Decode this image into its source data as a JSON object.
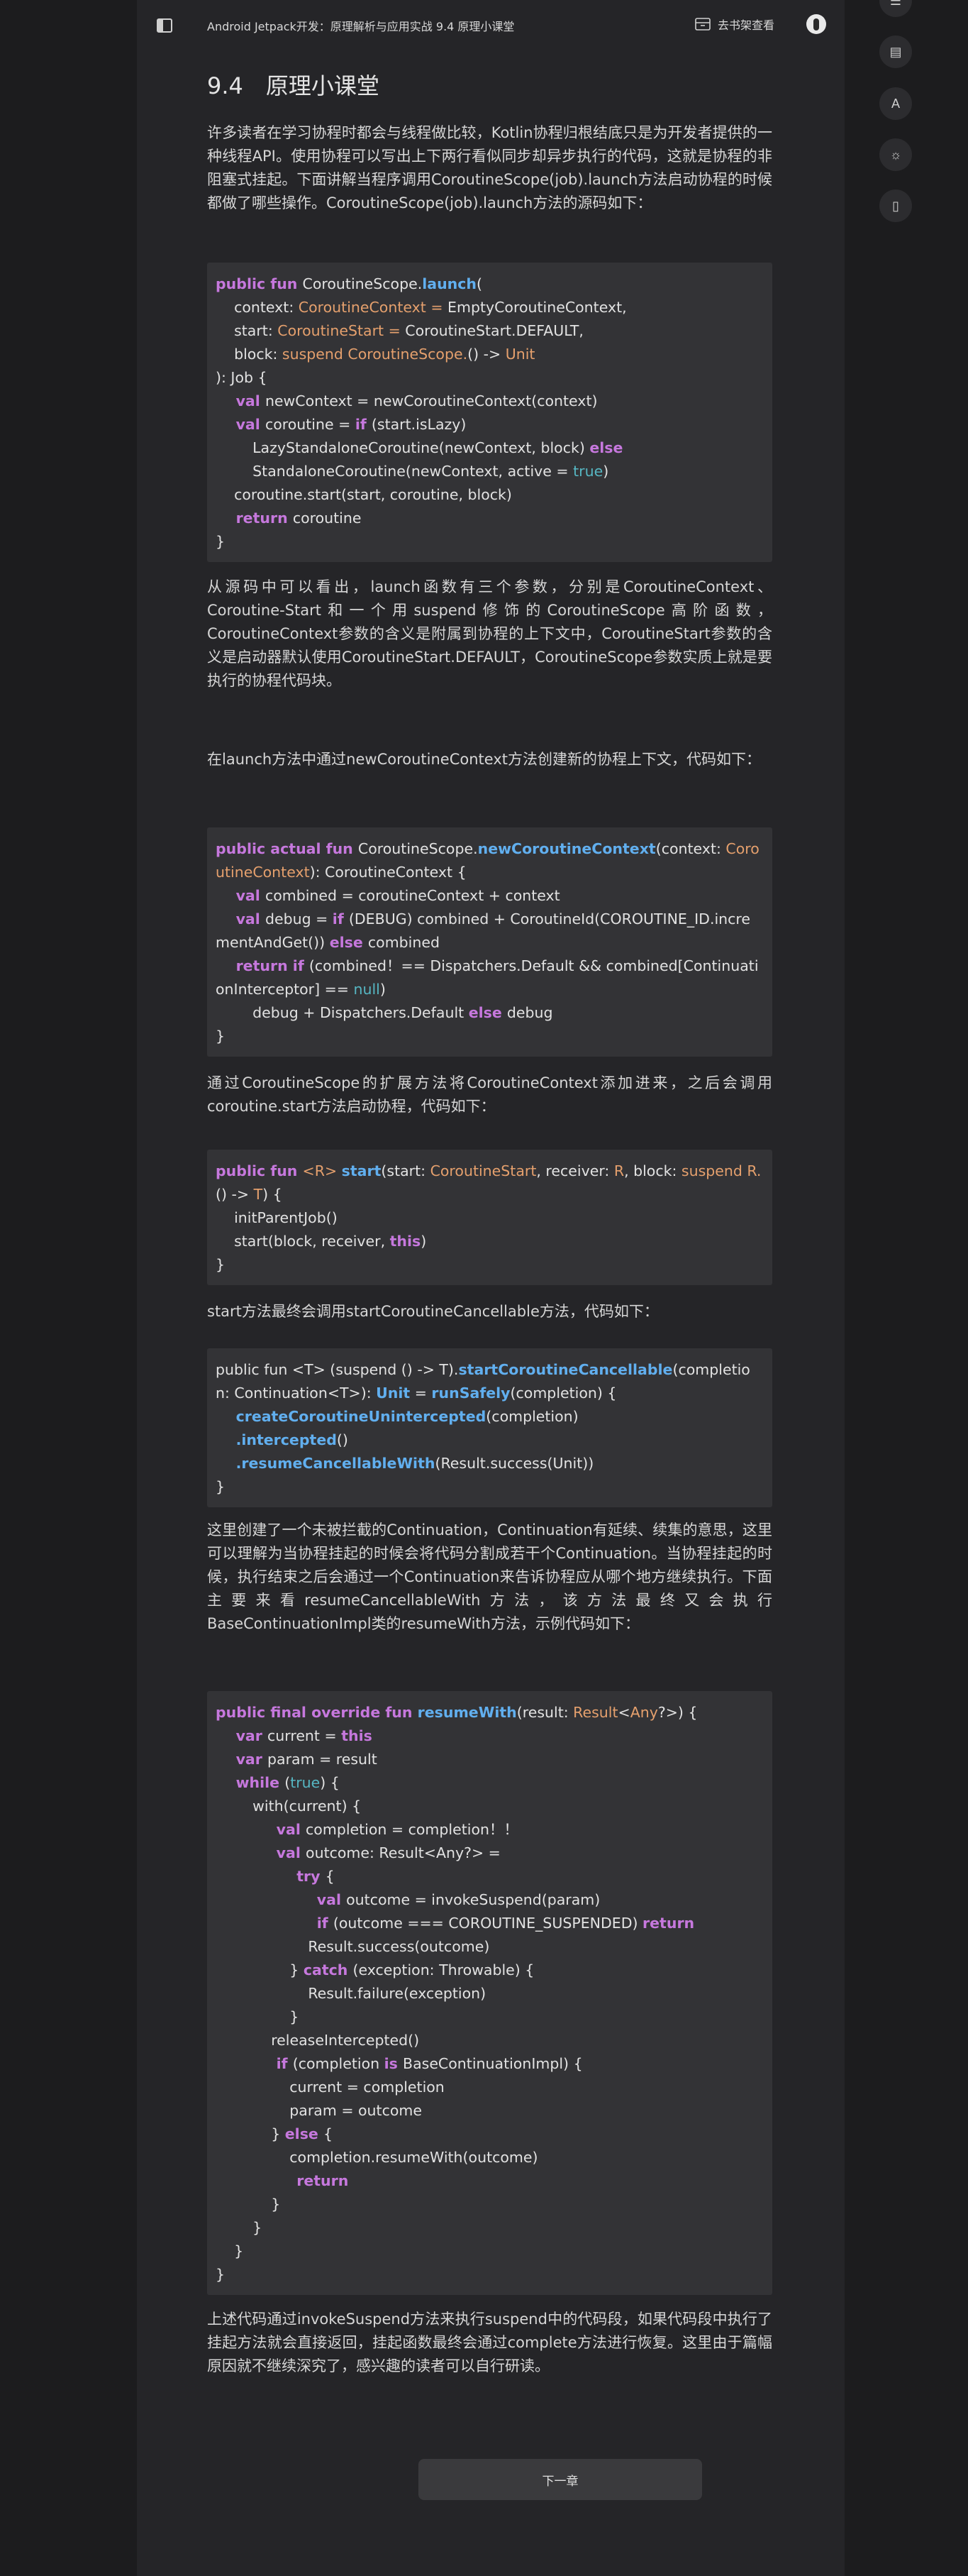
{
  "header": {
    "breadcrumb": "Android Jetpack开发：原理解析与应用实战 9.4 原理小课堂",
    "bookshelf_label": "去书架查看",
    "menu_icon": "menu-icon",
    "shelf_icon": "bookshelf-icon",
    "avatar_icon": "avatar-icon"
  },
  "article": {
    "title": "9.4　原理小课堂",
    "paragraphs": [
      "许多读者在学习协程时都会与线程做比较，Kotlin协程归根结底只是为开发者提供的一种线程API。使用协程可以写出上下两行看似同步却异步执行的代码，这就是协程的非阻塞式挂起。下面讲解当程序调用CoroutineScope(job).launch方法启动协程的时候都做了哪些操作。CoroutineScope(job).launch方法的源码如下：",
      "从源码中可以看出，launch函数有三个参数，分别是CoroutineContext、Coroutine-Start和一个用suspend修饰的CoroutineScope高阶函数，CoroutineContext参数的含义是附属到协程的上下文中，CoroutineStart参数的含义是启动器默认使用CoroutineStart.DEFAULT，CoroutineScope参数实质上就是要执行的协程代码块。",
      "在launch方法中通过newCoroutineContext方法创建新的协程上下文，代码如下：",
      "通过CoroutineScope的扩展方法将CoroutineContext添加进来，之后会调用coroutine.start方法启动协程，代码如下：",
      "start方法最终会调用startCoroutineCancellable方法，代码如下：",
      "这里创建了一个未被拦截的Continuation，Continuation有延续、续集的意思，这里可以理解为当协程挂起的时候会将代码分割成若干个Continuation。当协程挂起的时候，执行结束之后会通过一个Continuation来告诉协程应从哪个地方继续执行。下面主要来看resumeCancellableWith方法，该方法最终又会执行BaseContinuationImpl类的resumeWith方法，示例代码如下：",
      "上述代码通过invokeSuspend方法来执行suspend中的代码段，如果代码段中执行了挂起方法就会直接返回，挂起函数最终会通过complete方法进行恢复。这里由于篇幅原因就不继续深究了，感兴趣的读者可以自行研读。"
    ],
    "code_blocks": [
      [
        [
          [
            "kw",
            "public fun "
          ],
          [
            "",
            "CoroutineScope."
          ],
          [
            "fn",
            "launch"
          ],
          [
            "",
            "("
          ]
        ],
        [
          [
            "",
            "    context: "
          ],
          [
            "ty",
            "CoroutineContext"
          ],
          [
            "",
            ""
          ],
          [
            "ty",
            " = "
          ],
          [
            "",
            "EmptyCoroutineContext,"
          ]
        ],
        [
          [
            "",
            "    start: "
          ],
          [
            "ty",
            "CoroutineStart"
          ],
          [
            "ty",
            " = "
          ],
          [
            "",
            "CoroutineStart.DEFAULT,"
          ]
        ],
        [
          [
            "",
            "    block: "
          ],
          [
            "ty",
            "suspend CoroutineScope."
          ],
          [
            "",
            "() -> "
          ],
          [
            "ty",
            "Unit"
          ]
        ],
        [
          [
            "",
            "): Job {"
          ]
        ],
        [
          [
            "kw",
            "    val "
          ],
          [
            "",
            "newContext = newCoroutineContext(context)"
          ]
        ],
        [
          [
            "kw",
            "    val "
          ],
          [
            "",
            "coroutine = "
          ],
          [
            "kw",
            "if "
          ],
          [
            "",
            "(start.isLazy)"
          ]
        ],
        [
          [
            "",
            "        LazyStandaloneCoroutine(newContext, block) "
          ],
          [
            "kw",
            "else"
          ]
        ],
        [
          [
            "",
            "        StandaloneCoroutine(newContext, active = "
          ],
          [
            "lt",
            "true"
          ],
          [
            "",
            ")"
          ]
        ],
        [
          [
            "",
            "    coroutine.start(start, coroutine, block)"
          ]
        ],
        [
          [
            "kw",
            "    return "
          ],
          [
            "",
            "coroutine"
          ]
        ],
        [
          [
            "",
            "}"
          ]
        ]
      ],
      [
        [
          [
            "kw",
            "public actual fun "
          ],
          [
            "",
            "CoroutineScope."
          ],
          [
            "fn",
            "newCoroutineContext"
          ],
          [
            "",
            "(context: "
          ],
          [
            "ty",
            "CoroutineContext"
          ],
          [
            "",
            "): CoroutineContext {"
          ]
        ],
        [
          [
            "kw",
            "    val "
          ],
          [
            "",
            "combined = coroutineContext + context"
          ]
        ],
        [
          [
            "kw",
            "    val "
          ],
          [
            "",
            "debug = "
          ],
          [
            "kw",
            "if "
          ],
          [
            "",
            "(DEBUG) combined + CoroutineId(COROUTINE_ID.incrementAndGet()) "
          ],
          [
            "kw",
            "else "
          ],
          [
            "",
            "combined"
          ]
        ],
        [
          [
            "kw",
            "    return if "
          ],
          [
            "",
            "(combined！== Dispatchers.Default && combined[ContinuationInterceptor] == "
          ],
          [
            "lt",
            "null"
          ],
          [
            "",
            ")"
          ]
        ],
        [
          [
            "",
            "        debug + Dispatchers.Default "
          ],
          [
            "kw",
            "else "
          ],
          [
            "",
            "debug"
          ]
        ],
        [
          [
            "",
            "}"
          ]
        ]
      ],
      [
        [
          [
            "kw",
            "public fun "
          ],
          [
            "ty",
            "<R> "
          ],
          [
            "fn",
            "start"
          ],
          [
            "",
            "(start: "
          ],
          [
            "ty",
            "CoroutineStart"
          ],
          [
            "",
            ", receiver: "
          ],
          [
            "ty",
            "R"
          ],
          [
            "",
            ", block: "
          ],
          [
            "ty",
            "suspend R."
          ],
          [
            "",
            "() -> "
          ],
          [
            "ty",
            "T"
          ],
          [
            "",
            ") {"
          ]
        ],
        [
          [
            "",
            "    initParentJob()"
          ]
        ],
        [
          [
            "",
            "    start(block, receiver, "
          ],
          [
            "kw",
            "this"
          ],
          [
            "",
            ")"
          ]
        ],
        [
          [
            "",
            "}"
          ]
        ]
      ],
      [
        [
          [
            "",
            "public fun <T> (suspend () -> T)."
          ],
          [
            "fn",
            "startCoroutineCancellable"
          ],
          [
            "",
            "(completion: Continuation<T>): "
          ],
          [
            "fn",
            "Unit"
          ],
          [
            "",
            " = "
          ],
          [
            "fn",
            "runSafely"
          ],
          [
            "",
            "(completion) {"
          ]
        ],
        [
          [
            "fn",
            "    createCoroutineUnintercepted"
          ],
          [
            "",
            "(completion)"
          ]
        ],
        [
          [
            "fn",
            "    .intercepted"
          ],
          [
            "",
            "()"
          ]
        ],
        [
          [
            "fn",
            "    .resumeCancellableWith"
          ],
          [
            "",
            "(Result.success(Unit))"
          ]
        ],
        [
          [
            "",
            "}"
          ]
        ]
      ],
      [
        [
          [
            "kw",
            "public final override fun "
          ],
          [
            "fn",
            "resumeWith"
          ],
          [
            "",
            "(result: "
          ],
          [
            "ty",
            "Result"
          ],
          [
            "",
            "<"
          ],
          [
            "ty",
            "Any"
          ],
          [
            "",
            "?>) {"
          ]
        ],
        [
          [
            "kw",
            "    var "
          ],
          [
            "",
            "current = "
          ],
          [
            "kw",
            "this"
          ]
        ],
        [
          [
            "kw",
            "    var "
          ],
          [
            "",
            "param = result"
          ]
        ],
        [
          [
            "kw",
            "    while "
          ],
          [
            "",
            "("
          ],
          [
            "lt",
            "true"
          ],
          [
            "",
            ") {"
          ]
        ],
        [
          [
            "",
            "        with(current) {"
          ]
        ],
        [
          [
            "kw",
            "            val "
          ],
          [
            "",
            "completion = completion！！"
          ]
        ],
        [
          [
            "kw",
            "            val "
          ],
          [
            "",
            "outcome: Result<Any?> ="
          ]
        ],
        [
          [
            "kw",
            "                try "
          ],
          [
            "",
            "{"
          ]
        ],
        [
          [
            "kw",
            "                    val "
          ],
          [
            "",
            "outcome = invokeSuspend(param)"
          ]
        ],
        [
          [
            "kw",
            "                    if "
          ],
          [
            "",
            "(outcome === COROUTINE_SUSPENDED) "
          ],
          [
            "kw",
            "return"
          ]
        ],
        [
          [
            "",
            "                    Result.success(outcome)"
          ]
        ],
        [
          [
            "",
            "                } "
          ],
          [
            "kw",
            "catch "
          ],
          [
            "",
            "(exception: Throwable) {"
          ]
        ],
        [
          [
            "",
            "                    Result.failure(exception)"
          ]
        ],
        [
          [
            "",
            "                }"
          ]
        ],
        [
          [
            "",
            "            releaseIntercepted()"
          ]
        ],
        [
          [
            "kw",
            "            if "
          ],
          [
            "",
            "(completion "
          ],
          [
            "kw",
            "is "
          ],
          [
            "",
            "BaseContinuationImpl) {"
          ]
        ],
        [
          [
            "",
            "                current = completion"
          ]
        ],
        [
          [
            "",
            "                param = outcome"
          ]
        ],
        [
          [
            "",
            "            } "
          ],
          [
            "kw",
            "else "
          ],
          [
            "",
            "{"
          ]
        ],
        [
          [
            "",
            "                completion.resumeWith(outcome)"
          ]
        ],
        [
          [
            "kw",
            "                return"
          ]
        ],
        [
          [
            "",
            "            }"
          ]
        ],
        [
          [
            "",
            "        }"
          ]
        ],
        [
          [
            "",
            "    }"
          ]
        ],
        [
          [
            "",
            "}"
          ]
        ]
      ]
    ]
  },
  "next_chapter_label": "下一章",
  "side_tools": [
    {
      "name": "list-icon",
      "glyph": "☰"
    },
    {
      "name": "comment-icon",
      "glyph": "▤"
    },
    {
      "name": "font-icon",
      "glyph": "A"
    },
    {
      "name": "brightness-icon",
      "glyph": "☼"
    },
    {
      "name": "phone-icon",
      "glyph": "▯"
    }
  ],
  "colors": {
    "background": "#1c1c1e",
    "page": "#252528",
    "code_bg": "#333336",
    "keyword": "#c678dd",
    "function": "#61afef",
    "type": "#e5a06d",
    "literal": "#56b6c2"
  }
}
